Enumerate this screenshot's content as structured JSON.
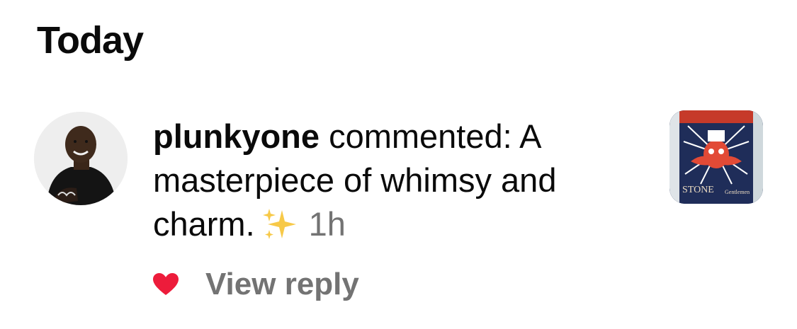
{
  "section": {
    "title": "Today"
  },
  "notification": {
    "username": "plunkyone",
    "action_text": " commented: A masterpiece of whimsy and charm.",
    "emoji": "sparkles",
    "timestamp": "1h",
    "avatar_icon": "user-avatar-photo",
    "thumbnail_icon": "post-thumbnail-poster",
    "thumbnail_text": {
      "left_line": "STONE",
      "right_line": "Gentlemen"
    },
    "like_icon": "heart-icon",
    "like_color": "#ed1c3b",
    "view_reply_label": "View reply"
  },
  "colors": {
    "text_primary": "#0a0a0a",
    "text_secondary": "#737373",
    "background": "#ffffff"
  }
}
